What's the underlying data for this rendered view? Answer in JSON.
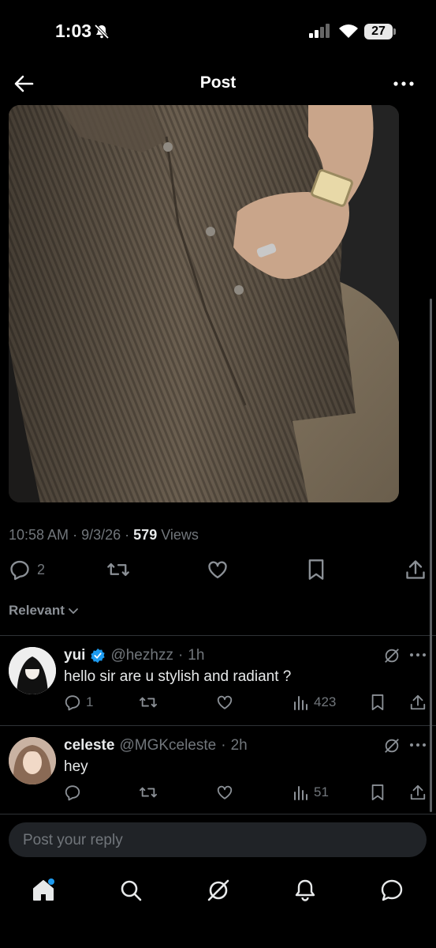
{
  "status_bar": {
    "time": "1:03",
    "battery": "27"
  },
  "header": {
    "title": "Post"
  },
  "post": {
    "time": "10:58 AM",
    "sep1": "·",
    "date": "9/3/26",
    "sep2": "·",
    "views_count": "579",
    "views_label": "Views",
    "replies": "2"
  },
  "sort": {
    "label": "Relevant"
  },
  "replies": [
    {
      "name": "yui",
      "handle": "@hezhzz",
      "sep": "·",
      "time": "1h",
      "text": "hello sir are u stylish and radiant ?",
      "replies": "1",
      "views": "423",
      "verified": true
    },
    {
      "name": "celeste",
      "handle": "@MGKceleste",
      "sep": "·",
      "time": "2h",
      "text": "hey",
      "replies": "",
      "views": "51",
      "verified": false
    }
  ],
  "composer": {
    "placeholder": "Post your reply"
  },
  "colors": {
    "accent": "#1d9bf0",
    "muted": "#71767b",
    "text": "#e7e9ea",
    "background": "#000000"
  },
  "icons": [
    "back-arrow-icon",
    "more-dots-icon",
    "reply-icon",
    "retweet-icon",
    "like-icon",
    "bookmark-icon",
    "share-icon",
    "grok-icon",
    "views-icon",
    "home-icon",
    "search-icon",
    "notifications-icon",
    "messages-icon"
  ]
}
